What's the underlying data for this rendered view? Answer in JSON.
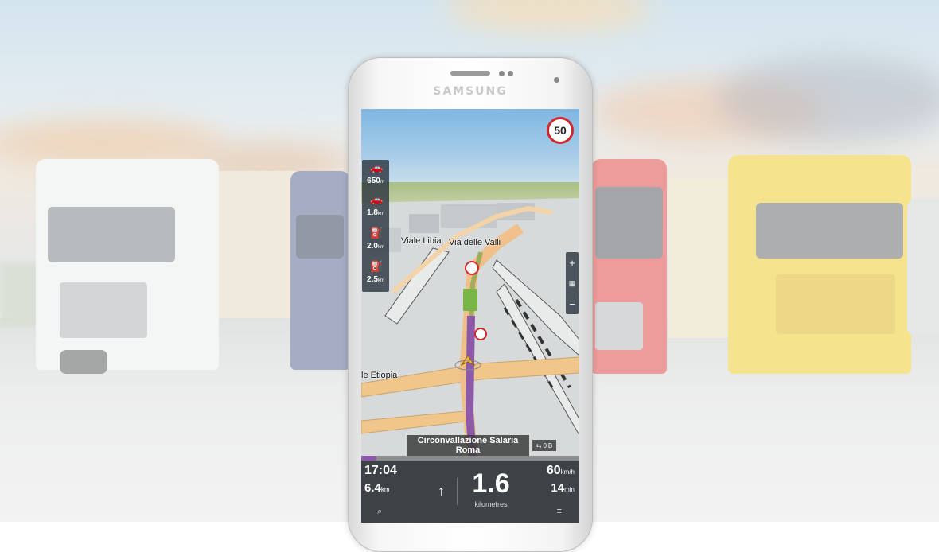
{
  "phone": {
    "brand": "SAMSUNG"
  },
  "map": {
    "speed_limit": "50",
    "street_labels": [
      "Viale Libia",
      "Via delle Valli",
      "le Etiopia"
    ],
    "current_street_line1": "Circonvallazione Salaria",
    "current_street_line2": "Roma",
    "traffic_value": "0",
    "route_progress": 0.07,
    "colors": {
      "route": "#8c5aa8",
      "road_major": "#f0c080",
      "speed_sign_border": "#d2262c"
    }
  },
  "poi_panel": [
    {
      "icon": "car-icon",
      "glyph": "🚗",
      "value": "650",
      "unit": "m"
    },
    {
      "icon": "car-icon",
      "glyph": "🚗",
      "value": "1.8",
      "unit": "km"
    },
    {
      "icon": "fuel-icon",
      "glyph": "⛽",
      "value": "2.0",
      "unit": "km"
    },
    {
      "icon": "fuel-icon",
      "glyph": "⛽",
      "value": "2.5",
      "unit": "km"
    }
  ],
  "zoom": {
    "plus": "+",
    "minus": "−"
  },
  "bottom_bar": {
    "arrival_time": "17:04",
    "remaining_distance": "6.4",
    "remaining_unit": "km",
    "next_maneuver_distance": "1.6",
    "next_maneuver_unit": "kilometres",
    "speed": "60",
    "speed_unit": "km/h",
    "remaining_time": "14",
    "remaining_time_unit": "min"
  }
}
